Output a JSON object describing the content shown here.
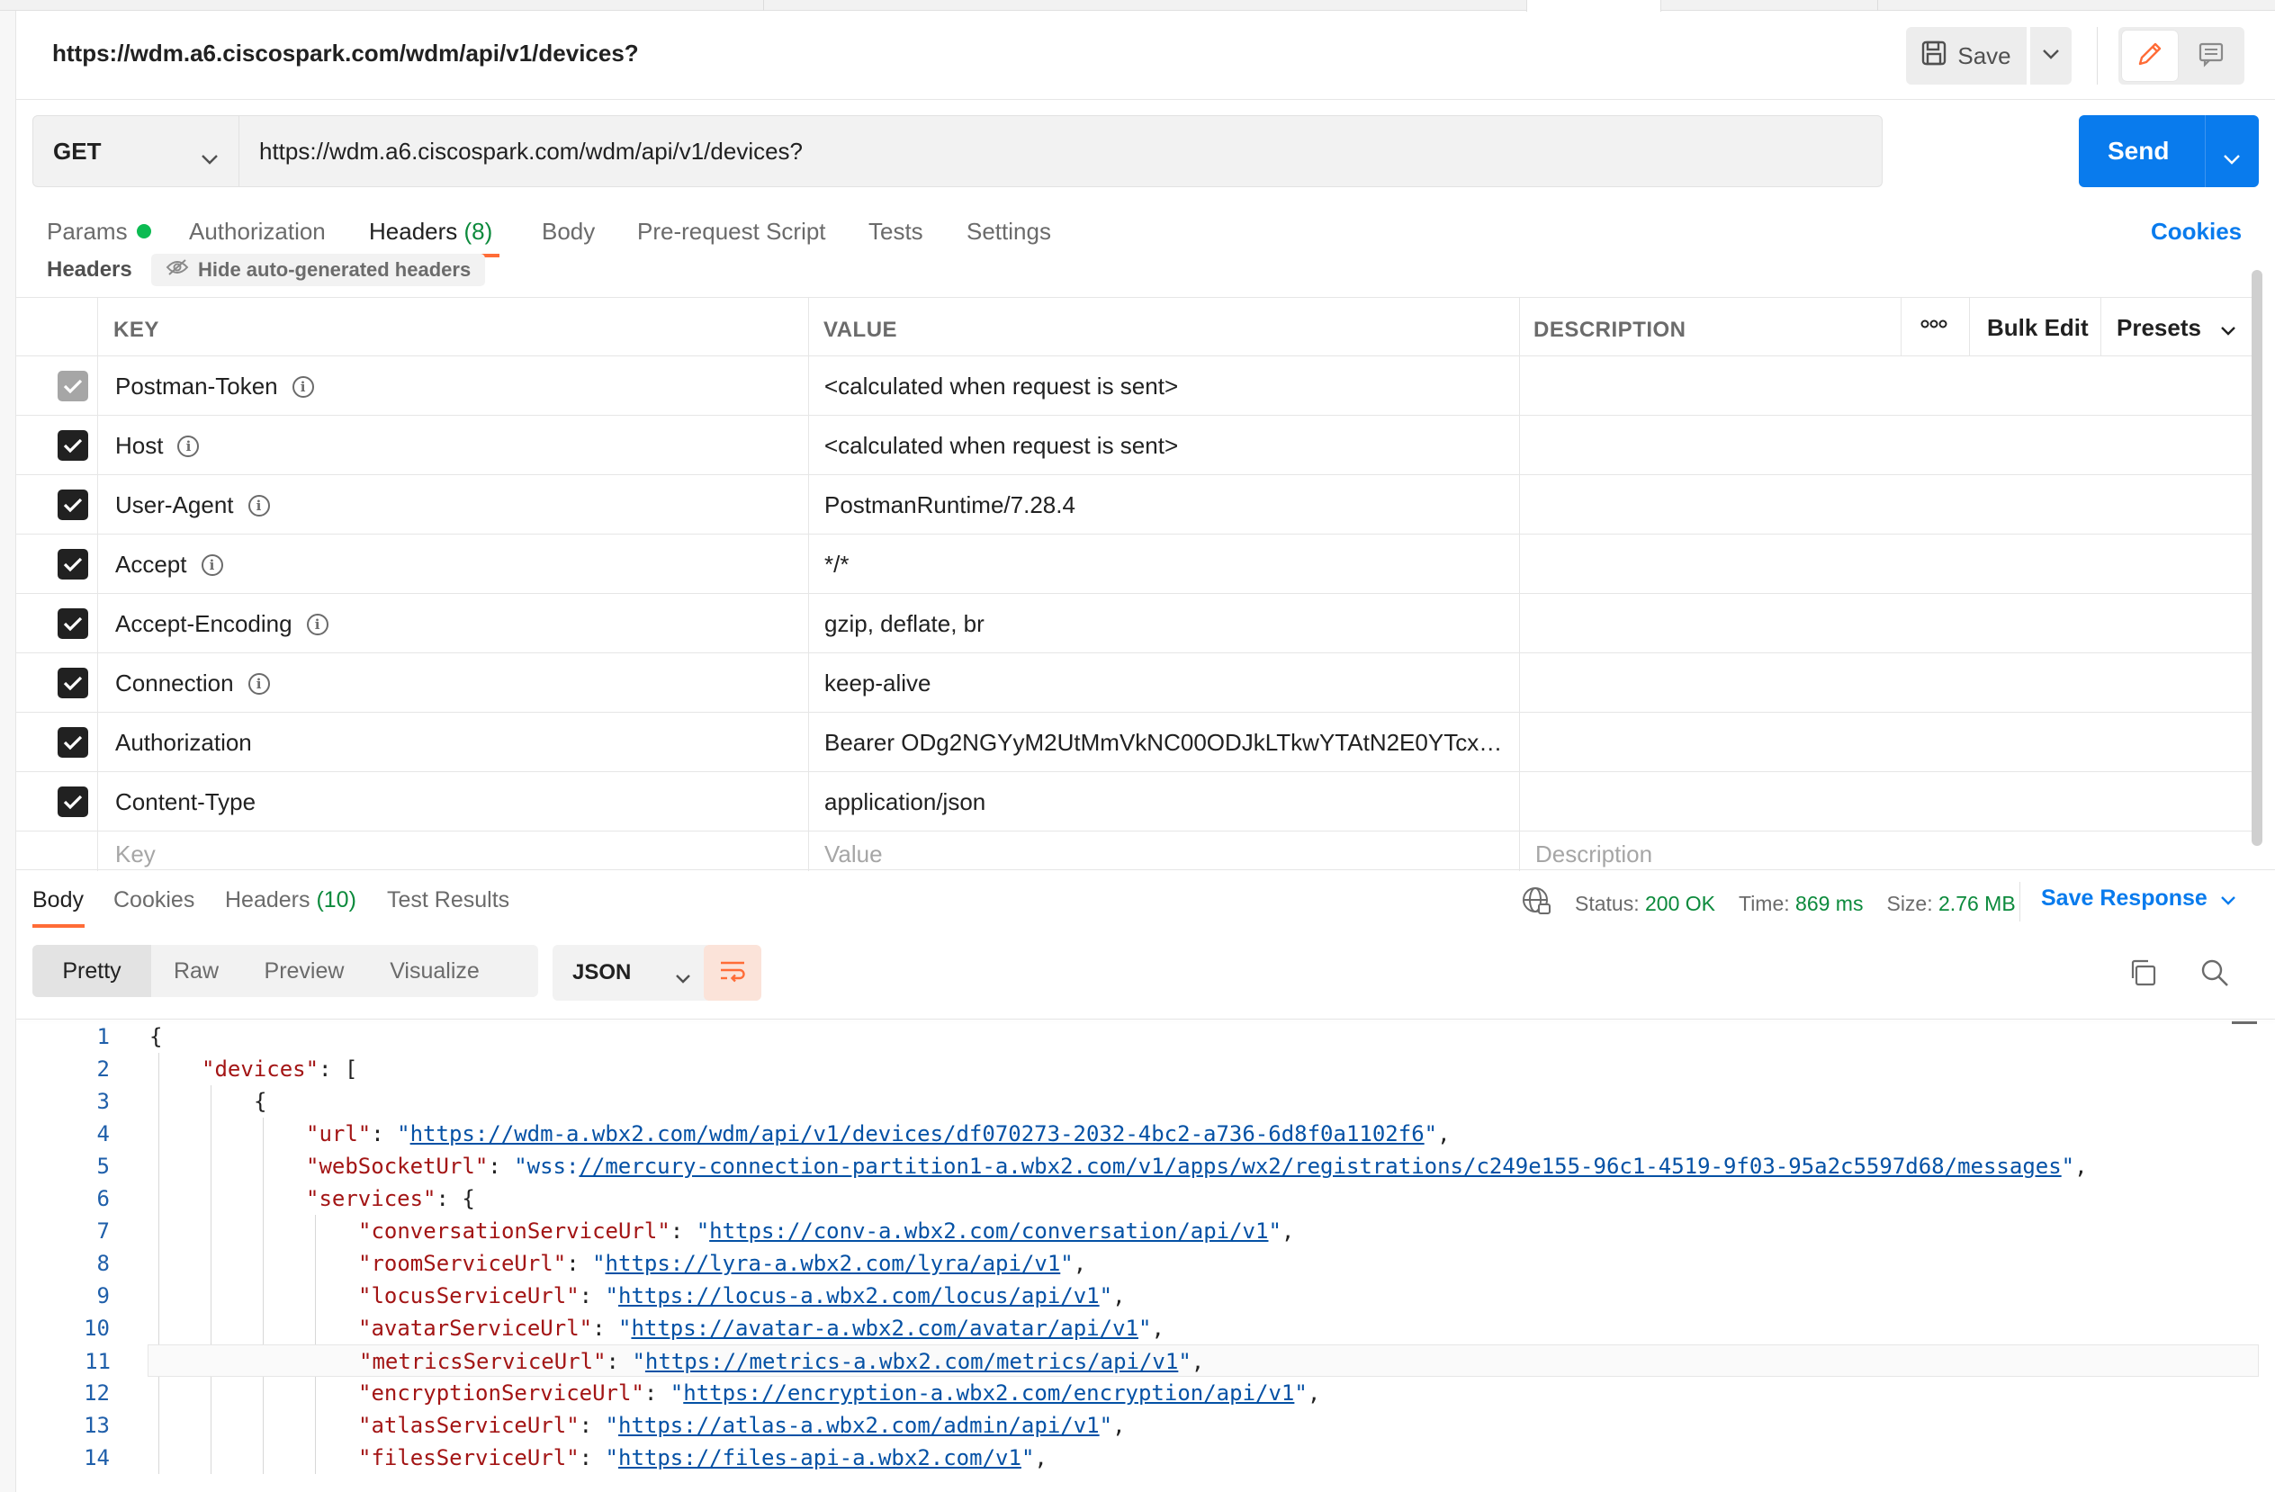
{
  "request": {
    "title": "https://wdm.a6.ciscospark.com/wdm/api/v1/devices?",
    "save_label": "Save",
    "method": "GET",
    "url": "https://wdm.a6.ciscospark.com/wdm/api/v1/devices?",
    "send_label": "Send"
  },
  "request_tabs": {
    "params": "Params",
    "authorization": "Authorization",
    "headers": "Headers",
    "headers_count": "(8)",
    "body": "Body",
    "prerequest": "Pre-request Script",
    "tests": "Tests",
    "settings": "Settings",
    "cookies": "Cookies"
  },
  "headers_section": {
    "label": "Headers",
    "hide_auto": "Hide auto-generated headers",
    "col_key": "KEY",
    "col_value": "VALUE",
    "col_description": "DESCRIPTION",
    "bulk_edit": "Bulk Edit",
    "presets": "Presets",
    "rows": [
      {
        "key": "Postman-Token",
        "value": "<calculated when request is sent>",
        "info": true,
        "checked": true,
        "disabled": true
      },
      {
        "key": "Host",
        "value": "<calculated when request is sent>",
        "info": true,
        "checked": true,
        "disabled": false
      },
      {
        "key": "User-Agent",
        "value": "PostmanRuntime/7.28.4",
        "info": true,
        "checked": true,
        "disabled": false
      },
      {
        "key": "Accept",
        "value": "*/*",
        "info": true,
        "checked": true,
        "disabled": false
      },
      {
        "key": "Accept-Encoding",
        "value": "gzip, deflate, br",
        "info": true,
        "checked": true,
        "disabled": false
      },
      {
        "key": "Connection",
        "value": "keep-alive",
        "info": true,
        "checked": true,
        "disabled": false
      },
      {
        "key": "Authorization",
        "value": "Bearer ODg2NGYyM2UtMmVkNC00ODJkLTkwYTAtN2E0YTcxNjc...",
        "info": false,
        "checked": true,
        "disabled": false
      },
      {
        "key": "Content-Type",
        "value": "application/json",
        "info": false,
        "checked": true,
        "disabled": false
      }
    ],
    "placeholder_key": "Key",
    "placeholder_value": "Value",
    "placeholder_description": "Description"
  },
  "response": {
    "tabs": {
      "body": "Body",
      "cookies": "Cookies",
      "headers": "Headers",
      "headers_count": "(10)",
      "test_results": "Test Results"
    },
    "status_label": "Status:",
    "status_value": "200 OK",
    "time_label": "Time:",
    "time_value": "869 ms",
    "size_label": "Size:",
    "size_value": "2.76 MB",
    "save_response": "Save Response",
    "views": [
      "Pretty",
      "Raw",
      "Preview",
      "Visualize"
    ],
    "format": "JSON"
  },
  "code_lines": [
    {
      "n": "1",
      "indent": 0,
      "parts": [
        [
          "p",
          "{"
        ]
      ]
    },
    {
      "n": "2",
      "indent": 1,
      "parts": [
        [
          "k",
          "\"devices\""
        ],
        [
          "p",
          ": ["
        ]
      ]
    },
    {
      "n": "3",
      "indent": 2,
      "parts": [
        [
          "p",
          "{"
        ]
      ]
    },
    {
      "n": "4",
      "indent": 3,
      "parts": [
        [
          "k",
          "\"url\""
        ],
        [
          "p",
          ": "
        ],
        [
          "s",
          "\""
        ],
        [
          "u",
          "https://wdm-a.wbx2.com/wdm/api/v1/devices/df070273-2032-4bc2-a736-6d8f0a1102f6"
        ],
        [
          "s",
          "\""
        ],
        [
          "p",
          ","
        ]
      ]
    },
    {
      "n": "5",
      "indent": 3,
      "parts": [
        [
          "k",
          "\"webSocketUrl\""
        ],
        [
          "p",
          ": "
        ],
        [
          "s",
          "\"wss:"
        ],
        [
          "u",
          "//mercury-connection-partition1-a.wbx2.com/v1/apps/wx2/registrations/c249e155-96c1-4519-9f03-95a2c5597d68/messages"
        ],
        [
          "s",
          "\""
        ],
        [
          "p",
          ","
        ]
      ]
    },
    {
      "n": "6",
      "indent": 3,
      "parts": [
        [
          "k",
          "\"services\""
        ],
        [
          "p",
          ": {"
        ]
      ]
    },
    {
      "n": "7",
      "indent": 4,
      "parts": [
        [
          "k",
          "\"conversationServiceUrl\""
        ],
        [
          "p",
          ": "
        ],
        [
          "s",
          "\""
        ],
        [
          "u",
          "https://conv-a.wbx2.com/conversation/api/v1"
        ],
        [
          "s",
          "\""
        ],
        [
          "p",
          ","
        ]
      ]
    },
    {
      "n": "8",
      "indent": 4,
      "parts": [
        [
          "k",
          "\"roomServiceUrl\""
        ],
        [
          "p",
          ": "
        ],
        [
          "s",
          "\""
        ],
        [
          "u",
          "https://lyra-a.wbx2.com/lyra/api/v1"
        ],
        [
          "s",
          "\""
        ],
        [
          "p",
          ","
        ]
      ]
    },
    {
      "n": "9",
      "indent": 4,
      "parts": [
        [
          "k",
          "\"locusServiceUrl\""
        ],
        [
          "p",
          ": "
        ],
        [
          "s",
          "\""
        ],
        [
          "u",
          "https://locus-a.wbx2.com/locus/api/v1"
        ],
        [
          "s",
          "\""
        ],
        [
          "p",
          ","
        ]
      ]
    },
    {
      "n": "10",
      "indent": 4,
      "parts": [
        [
          "k",
          "\"avatarServiceUrl\""
        ],
        [
          "p",
          ": "
        ],
        [
          "s",
          "\""
        ],
        [
          "u",
          "https://avatar-a.wbx2.com/avatar/api/v1"
        ],
        [
          "s",
          "\""
        ],
        [
          "p",
          ","
        ]
      ]
    },
    {
      "n": "11",
      "indent": 4,
      "highlight": true,
      "parts": [
        [
          "k",
          "\"metricsServiceUrl\""
        ],
        [
          "p",
          ": "
        ],
        [
          "s",
          "\""
        ],
        [
          "u",
          "https://metrics-a.wbx2.com/metrics/api/v1"
        ],
        [
          "s",
          "\""
        ],
        [
          "p",
          ","
        ]
      ]
    },
    {
      "n": "12",
      "indent": 4,
      "parts": [
        [
          "k",
          "\"encryptionServiceUrl\""
        ],
        [
          "p",
          ": "
        ],
        [
          "s",
          "\""
        ],
        [
          "u",
          "https://encryption-a.wbx2.com/encryption/api/v1"
        ],
        [
          "s",
          "\""
        ],
        [
          "p",
          ","
        ]
      ]
    },
    {
      "n": "13",
      "indent": 4,
      "parts": [
        [
          "k",
          "\"atlasServiceUrl\""
        ],
        [
          "p",
          ": "
        ],
        [
          "s",
          "\""
        ],
        [
          "u",
          "https://atlas-a.wbx2.com/admin/api/v1"
        ],
        [
          "s",
          "\""
        ],
        [
          "p",
          ","
        ]
      ]
    },
    {
      "n": "14",
      "indent": 4,
      "parts": [
        [
          "k",
          "\"filesServiceUrl\""
        ],
        [
          "p",
          ": "
        ],
        [
          "s",
          "\""
        ],
        [
          "u",
          "https://files-api-a.wbx2.com/v1"
        ],
        [
          "s",
          "\""
        ],
        [
          "p",
          ","
        ]
      ]
    }
  ],
  "colors": {
    "accent": "#ff6c37",
    "send": "#097bed",
    "status_green": "#0c8a3c"
  },
  "icons": [
    "save-icon",
    "chevron-down-icon",
    "pencil-icon",
    "comment-icon",
    "eye-off-icon",
    "info-icon",
    "checkbox-icon",
    "more-icon",
    "globe-icon",
    "wrap-icon",
    "copy-icon",
    "search-icon"
  ]
}
